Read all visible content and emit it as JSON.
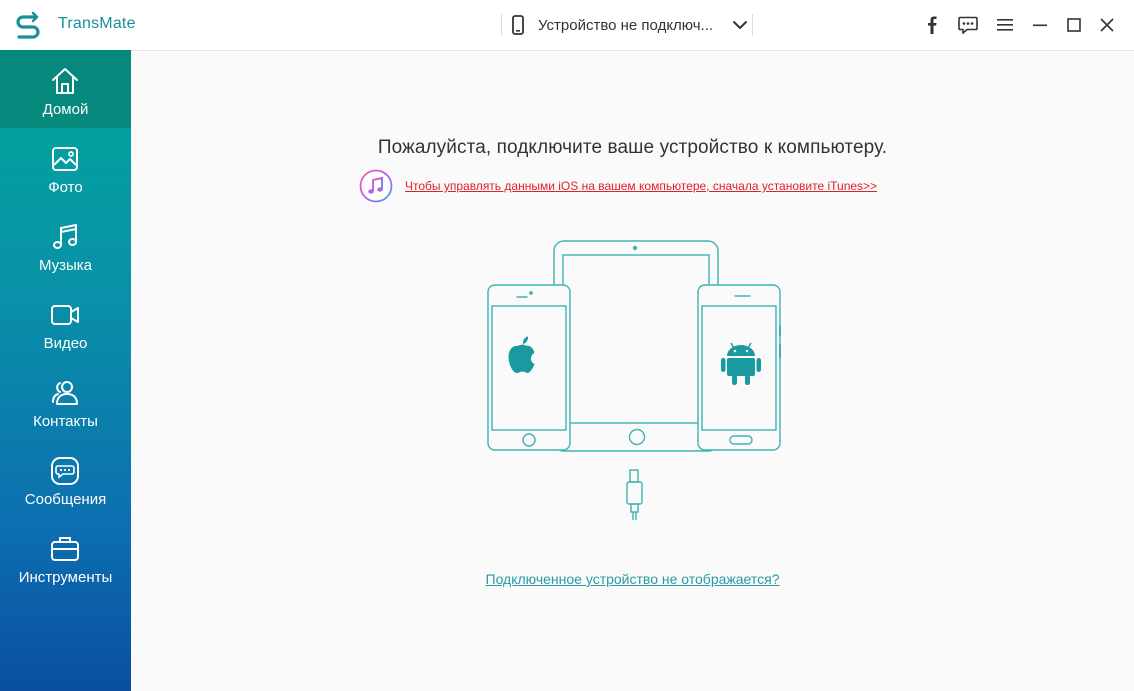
{
  "app": {
    "title": "TransMate",
    "logo_icon": "transmate-logo-icon"
  },
  "device_selector": {
    "label": "Устройство не подключ...",
    "icon": "phone-icon",
    "dropdown_icon": "chevron-down-icon"
  },
  "titlebar_buttons": [
    {
      "name": "facebook",
      "icon": "facebook-icon"
    },
    {
      "name": "feedback",
      "icon": "chat-icon"
    },
    {
      "name": "menu",
      "icon": "hamburger-menu-icon"
    },
    {
      "name": "minimize",
      "icon": "minimize-icon"
    },
    {
      "name": "maximize",
      "icon": "maximize-icon"
    },
    {
      "name": "close",
      "icon": "close-icon"
    }
  ],
  "sidebar": {
    "items": [
      {
        "label": "Домой",
        "icon": "home-icon",
        "active": true
      },
      {
        "label": "Фото",
        "icon": "photo-icon",
        "active": false
      },
      {
        "label": "Музыка",
        "icon": "music-icon",
        "active": false
      },
      {
        "label": "Видео",
        "icon": "video-icon",
        "active": false
      },
      {
        "label": "Контакты",
        "icon": "contacts-icon",
        "active": false
      },
      {
        "label": "Сообщения",
        "icon": "messages-icon",
        "active": false
      },
      {
        "label": "Инструменты",
        "icon": "toolbox-icon",
        "active": false
      }
    ]
  },
  "main": {
    "title": "Пожалуйста, подключите ваше устройство к компьютеру.",
    "itunes_link": "Чтобы управлять данными iOS на вашем компьютере, сначала установите iTunes>>",
    "not_shown_link": "Подключенное устройство не отображается?"
  },
  "colors": {
    "accent": "#1a8f99",
    "sidebar_top": "#00a89b",
    "sidebar_bottom": "#0a4fa0",
    "sidebar_active": "#06887d",
    "link_red": "#e0202a",
    "link_teal": "#2a9aa6"
  }
}
